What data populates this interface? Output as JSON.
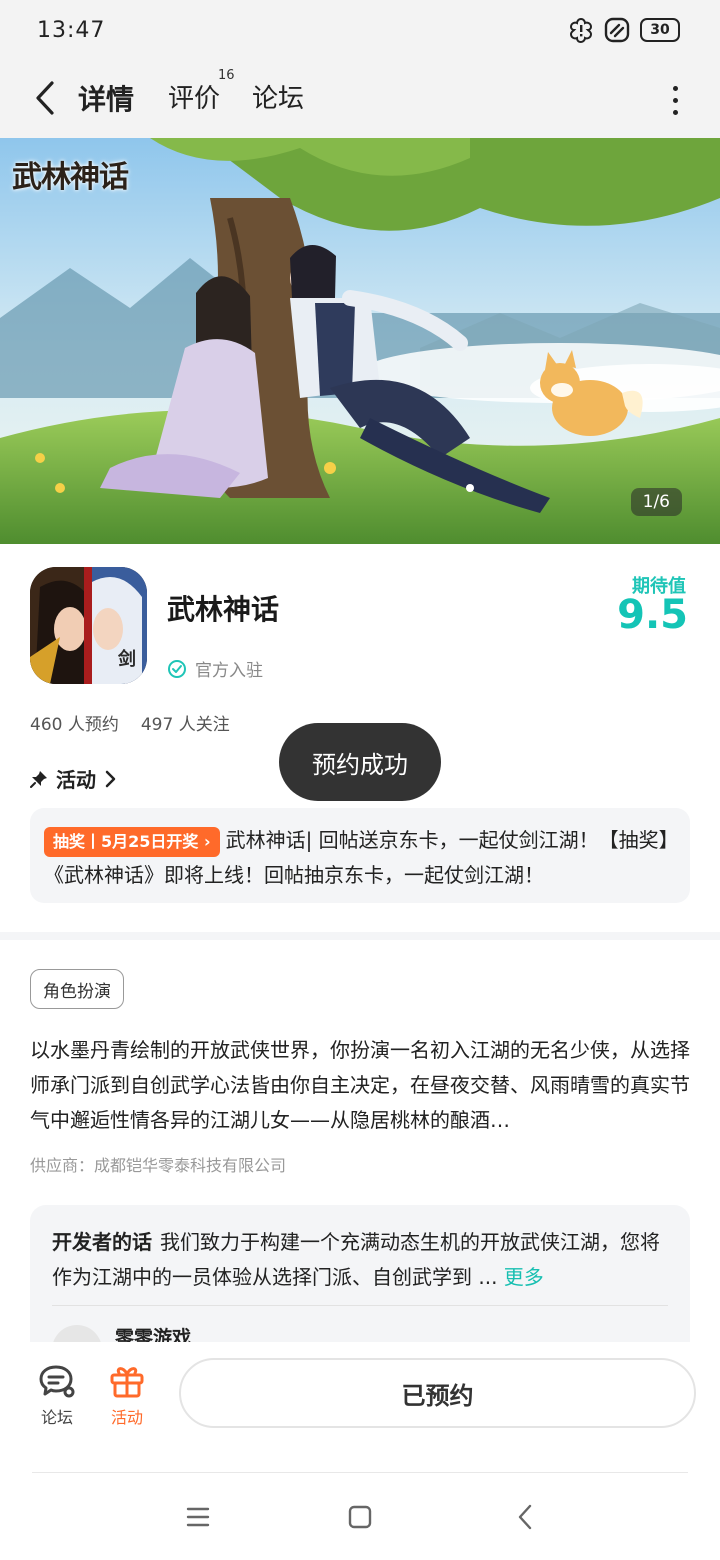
{
  "status_bar": {
    "time": "13:47",
    "battery": "30",
    "icons": [
      "alert-flower-icon",
      "no-disturb-icon",
      "battery-icon"
    ]
  },
  "nav": {
    "tabs": [
      {
        "label": "详情",
        "active": true
      },
      {
        "label": "评价",
        "badge": "16"
      },
      {
        "label": "论坛"
      }
    ]
  },
  "banner": {
    "logo_text": "武林神话",
    "counter": "1/6"
  },
  "app": {
    "name": "武林神话",
    "official_label": "官方入驻",
    "expect_label": "期待值",
    "expect_score": "9.5",
    "reservations": "460 人预约",
    "followers": "497 人关注"
  },
  "activity": {
    "heading": "活动",
    "tag": "抽奖丨5月25日开奖",
    "text": "武林神话| 回帖送京东卡，一起仗剑江湖！【抽奖】《武林神话》即将上线！回帖抽京东卡，一起仗剑江湖！"
  },
  "toast": "预约成功",
  "details": {
    "genre": "角色扮演",
    "description": "以水墨丹青绘制的开放武侠世界，你扮演一名初入江湖的无名少侠，从选择师承门派到自创武学心法皆由你自主决定，在昼夜交替、风雨晴雪的真实节气中邂逅性情各异的江湖儿女——从隐居桃林的酿酒…",
    "supplier": "供应商：成都铠华零泰科技有限公司"
  },
  "developer": {
    "title": "开发者的话",
    "text": "我们致力于构建一个充满动态生机的开放武侠江湖，您将作为江湖中的一员体验从选择门派、自创武学到 ...",
    "more": "更多",
    "author": "零零游戏"
  },
  "bottom_bar": {
    "forum_label": "论坛",
    "activity_label": "活动",
    "reserve_button": "已预约"
  },
  "colors": {
    "accent": "#1fc5b7",
    "orange": "#ff6a2a",
    "toast_bg": "#333333"
  }
}
